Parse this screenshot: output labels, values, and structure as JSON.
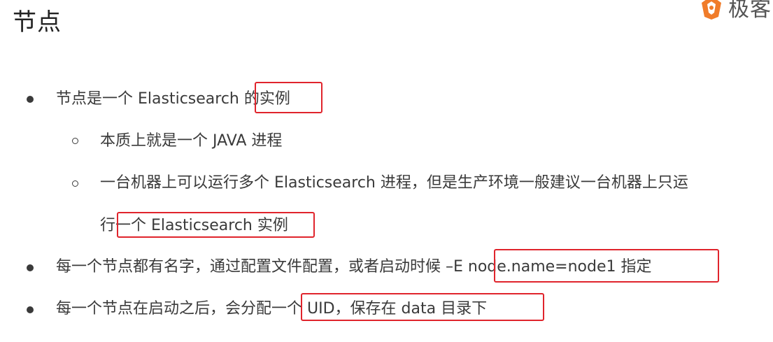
{
  "slide": {
    "title": "节点",
    "logo_text": "极客"
  },
  "bullets": [
    {
      "text": "节点是一个 Elasticsearch 的实例"
    },
    {
      "text": "本质上就是一个 JAVA 进程"
    },
    {
      "text": "一台机器上可以运行多个 Elasticsearch 进程，但是生产环境一般建议一台机器上只运"
    },
    {
      "text": "行一个 Elasticsearch 实例"
    },
    {
      "text": "每一个节点都有名字，通过配置文件配置，或者启动时候 –E node.name=node1 指定"
    },
    {
      "text": "每一个节点在启动之后，会分配一个 UID，保存在 data 目录下"
    }
  ],
  "colors": {
    "highlight_box": "#e0242c",
    "text": "#3a3a3a",
    "logo_accent": "#f07c2a"
  }
}
